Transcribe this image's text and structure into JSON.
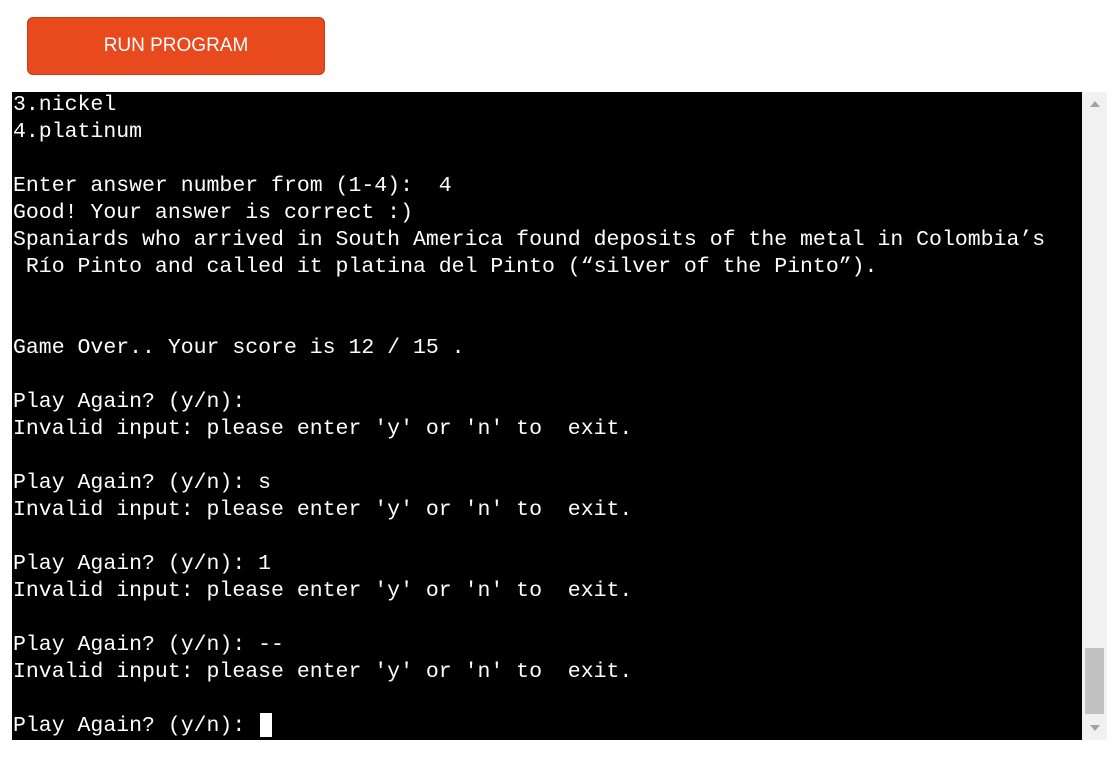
{
  "toolbar": {
    "run_label": "RUN PROGRAM",
    "accent_color": "#e8491d"
  },
  "terminal": {
    "lines": [
      "3.nickel",
      "4.platinum",
      "",
      "Enter answer number from (1-4):  4",
      "Good! Your answer is correct :)",
      "Spaniards who arrived in South America found deposits of the metal in Colombia’s",
      " Río Pinto and called it platina del Pinto (“silver of the Pinto”).",
      "",
      "",
      "Game Over.. Your score is 12 / 15 .",
      "",
      "Play Again? (y/n): ",
      "Invalid input: please enter 'y' or 'n' to  exit.",
      "",
      "Play Again? (y/n): s",
      "Invalid input: please enter 'y' or 'n' to  exit.",
      "",
      "Play Again? (y/n): 1",
      "Invalid input: please enter 'y' or 'n' to  exit.",
      "",
      "Play Again? (y/n): --",
      "Invalid input: please enter 'y' or 'n' to  exit.",
      "",
      "Play Again? (y/n): "
    ],
    "background_color": "#000000",
    "text_color": "#ffffff"
  },
  "scrollbar": {
    "up_icon": "triangle-up-icon",
    "down_icon": "triangle-down-icon"
  }
}
